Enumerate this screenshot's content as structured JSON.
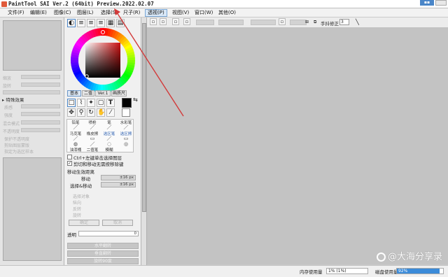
{
  "window": {
    "title": "PaintTool SAI Ver.2 (64bit) Preview.2022.02.07"
  },
  "menubar": {
    "items": [
      "文件(F)",
      "编辑(E)",
      "图像(C)",
      "图层(L)",
      "选择(S)",
      "尺子(R)",
      "透视(P)",
      "视图(V)",
      "窗口(W)",
      "其他(O)"
    ],
    "active_index": 6
  },
  "left_panel": {
    "special_effects": "特殊效果",
    "faded_labels": [
      "缩放",
      "旋转",
      "质感",
      "强度",
      "混合模式",
      "正常",
      "不透明度",
      "保护不透明度",
      "剪贴图层蒙版",
      "指定为选区样本"
    ]
  },
  "tool_panel": {
    "color_tabs": [
      "基本",
      "二值",
      "Ver.1",
      "画质尺"
    ],
    "brushes": [
      {
        "label": "铅笔"
      },
      {
        "label": "喷枪"
      },
      {
        "label": "笔"
      },
      {
        "label": "水彩笔"
      },
      {
        "label": "马克笔"
      },
      {
        "label": "橡皮擦"
      },
      {
        "label": "选区笔"
      },
      {
        "label": "选区擦"
      },
      {
        "label": "油漆桶"
      },
      {
        "label": "二值笔"
      },
      {
        "label": "模糊"
      },
      {
        "label": ""
      }
    ],
    "ctrl_option": "Ctrl+左键单击选择图层",
    "cut_option": "剪切和移动无需按移除键",
    "move_distance_title": "移动生效距离",
    "move_label": "移动",
    "move_value": "±16 px",
    "select_move_label": "选择&移动",
    "select_move_value": "±16 px",
    "greyed_options": [
      "选择对象",
      "纵向",
      "反转",
      "旋转"
    ],
    "ok_label": "确定",
    "cancel_label": "取消",
    "transparency_label": "透明",
    "transparency_value": "0",
    "flip_h": "水平翻转",
    "flip_v": "垂直翻转",
    "rotate_label": "旋转90度"
  },
  "canvas_toolbar": {
    "correction_label": "手抖修正",
    "correction_value": "3"
  },
  "status_bar": {
    "memory_label": "内存使用量",
    "memory_value": "1% (1%)",
    "disk_label": "磁盘使用量",
    "disk_value": "92%",
    "disk_fraction": 0.92
  },
  "watermark": "@大海分享录",
  "colors": {
    "annotation_arrow": "#d23a3a",
    "accent": "#3b8bd9",
    "canvas": "#c3c3c3"
  }
}
